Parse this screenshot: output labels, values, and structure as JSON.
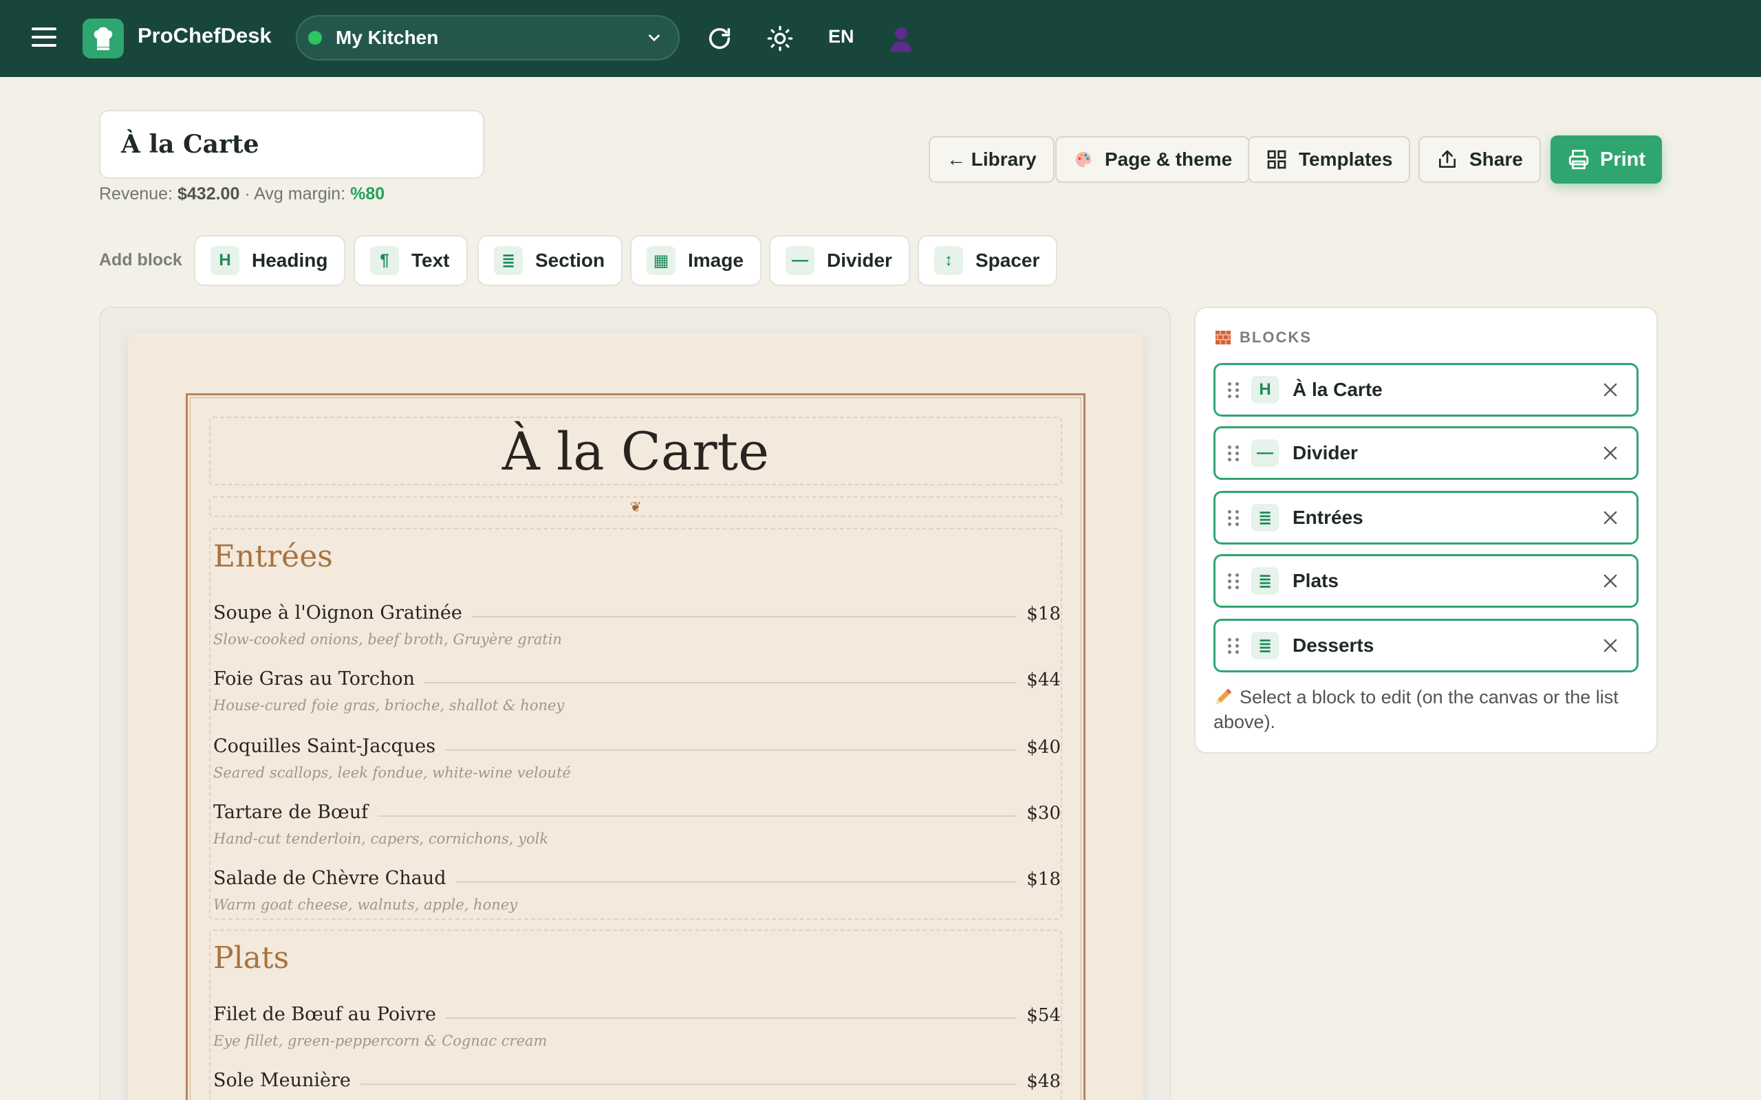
{
  "app": {
    "brand": "ProChefDesk",
    "kitchen": "My Kitchen",
    "lang": "EN"
  },
  "menu": {
    "name": "À la Carte",
    "revenue_label": "Revenue:",
    "revenue": "$432.00",
    "margin_label": "· Avg margin:",
    "margin": "%80"
  },
  "actions": {
    "library": "← Library",
    "page_theme": "Page & theme",
    "templates": "Templates",
    "share": "Share",
    "print": "Print"
  },
  "add_block": {
    "label": "Add block",
    "buttons": [
      {
        "icon": "H",
        "label": "Heading"
      },
      {
        "icon": "¶",
        "label": "Text"
      },
      {
        "icon": "≣",
        "label": "Section"
      },
      {
        "icon": "▦",
        "label": "Image"
      },
      {
        "icon": "—",
        "label": "Divider"
      },
      {
        "icon": "↕",
        "label": "Spacer"
      }
    ]
  },
  "canvas": {
    "title": "À la Carte",
    "divider_glyph": "❦",
    "sections": [
      {
        "title": "Entrées",
        "items": [
          {
            "name": "Soupe à l'Oignon Gratinée",
            "price": "$18",
            "desc": "Slow-cooked onions, beef broth, Gruyère gratin"
          },
          {
            "name": "Foie Gras au Torchon",
            "price": "$44",
            "desc": "House-cured foie gras, brioche, shallot & honey"
          },
          {
            "name": "Coquilles Saint-Jacques",
            "price": "$40",
            "desc": "Seared scallops, leek fondue, white-wine velouté"
          },
          {
            "name": "Tartare de Bœuf",
            "price": "$30",
            "desc": "Hand-cut tenderloin, capers, cornichons, yolk"
          },
          {
            "name": "Salade de Chèvre Chaud",
            "price": "$18",
            "desc": "Warm goat cheese, walnuts, apple, honey"
          }
        ]
      },
      {
        "title": "Plats",
        "items": [
          {
            "name": "Filet de Bœuf au Poivre",
            "price": "$54",
            "desc": "Eye fillet, green-peppercorn & Cognac cream"
          },
          {
            "name": "Sole Meunière",
            "price": "$48",
            "desc": ""
          }
        ]
      }
    ]
  },
  "blocks_panel": {
    "title": "BLOCKS",
    "items": [
      {
        "icon": "H",
        "label": "À la Carte"
      },
      {
        "icon": "—",
        "label": "Divider"
      },
      {
        "icon": "≣",
        "label": "Entrées"
      },
      {
        "icon": "≣",
        "label": "Plats"
      },
      {
        "icon": "≣",
        "label": "Desserts"
      }
    ],
    "hint": "Select a block to edit (on the canvas or the list above)."
  },
  "colors": {
    "topbar": "#18463b",
    "accent": "#2fa56f",
    "section_title": "#a7733f",
    "page": "#f3e9dd"
  }
}
